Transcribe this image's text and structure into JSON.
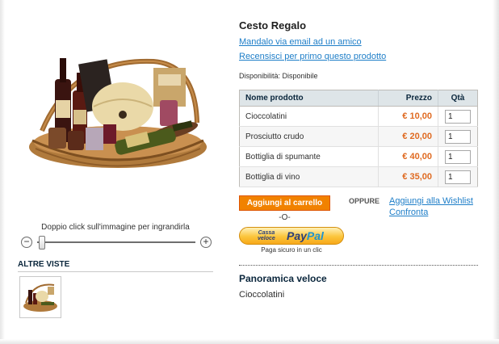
{
  "product": {
    "name": "Cesto Regalo",
    "email_link": "Mandalo via email ad un amico",
    "review_link": "Recensisci per primo questo prodotto",
    "availability": "Disponibilità: Disponibile"
  },
  "gallery": {
    "zoom_hint": "Doppio click sull'immagine per ingrandirla",
    "zoom_out_symbol": "−",
    "zoom_in_symbol": "+",
    "more_views_title": "ALTRE VISTE"
  },
  "grouped_table": {
    "headers": {
      "name": "Nome prodotto",
      "price": "Prezzo",
      "qty": "Qtà"
    },
    "rows": [
      {
        "name": "Cioccolatini",
        "price": "€ 10,00",
        "qty": "1"
      },
      {
        "name": "Prosciutto crudo",
        "price": "€ 20,00",
        "qty": "1"
      },
      {
        "name": "Bottiglia di spumante",
        "price": "€ 40,00",
        "qty": "1"
      },
      {
        "name": "Bottiglia di vino",
        "price": "€ 35,00",
        "qty": "1"
      }
    ]
  },
  "actions": {
    "add_to_cart": "Aggiungi al carrello",
    "or_separator": "-O-",
    "oppure": "OPPURE",
    "wishlist": "Aggiungi alla Wishlist",
    "compare": "Confronta"
  },
  "paypal": {
    "small_line1": "Cassa",
    "small_line2": "veloce",
    "logo_pay": "Pay",
    "logo_pal": "Pal",
    "note": "Paga sicuro in un clic",
    "colors": {
      "dark_blue": "#2a3f7a",
      "light_blue": "#1e93d1",
      "gold": "#fbc53b"
    }
  },
  "overview": {
    "title": "Panoramica veloce",
    "text": "Cioccolatini"
  },
  "colors": {
    "link": "#1e7ec8",
    "price": "#df6a21",
    "cart_button": "#f18200",
    "table_header": "#dee5e8"
  }
}
